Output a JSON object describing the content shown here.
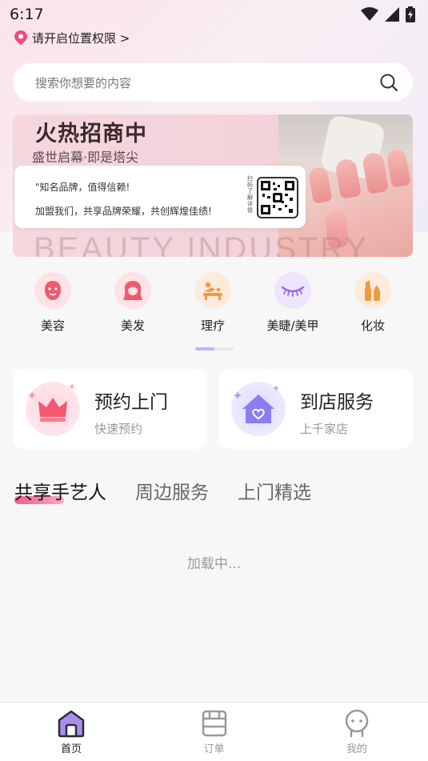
{
  "status_bar": {
    "time": "6:17"
  },
  "location": {
    "label": "请开启位置权限 >"
  },
  "search": {
    "placeholder": "搜索你想要的内容"
  },
  "banner": {
    "title": "火热招商中",
    "subtitle": "盛世启幕·即是塔尖",
    "card_line1": "\"知名品牌，值得信赖!",
    "card_line2": "加盟我们，共享品牌荣耀，共创辉煌佳绩!",
    "qr_label": "扫码了解详情",
    "watermark": "BEAUTY INDUSTRY"
  },
  "categories": [
    {
      "label": "美容",
      "icon": "face-mask-icon",
      "bg": "#fde2e6",
      "fg": "#ef5a6e"
    },
    {
      "label": "美发",
      "icon": "hair-icon",
      "bg": "#fde2e6",
      "fg": "#ef5a6e"
    },
    {
      "label": "理疗",
      "icon": "massage-icon",
      "bg": "#fdebdc",
      "fg": "#f09a3e"
    },
    {
      "label": "美睫/美甲",
      "icon": "eyelash-icon",
      "bg": "#eee4fb",
      "fg": "#9a6ae6"
    },
    {
      "label": "化妆",
      "icon": "makeup-icon",
      "bg": "#fdebdc",
      "fg": "#f09a3e"
    }
  ],
  "services": [
    {
      "title": "预约上门",
      "subtitle": "快速预约",
      "icon": "crown-icon"
    },
    {
      "title": "到店服务",
      "subtitle": "上千家店",
      "icon": "house-heart-icon"
    }
  ],
  "tabs": [
    {
      "label": "共享手艺人",
      "active": true
    },
    {
      "label": "周边服务",
      "active": false
    },
    {
      "label": "上门精选",
      "active": false
    }
  ],
  "loading_text": "加载中...",
  "tabbar": [
    {
      "label": "首页",
      "icon": "home-icon",
      "active": true
    },
    {
      "label": "订单",
      "icon": "order-icon",
      "active": false
    },
    {
      "label": "我的",
      "icon": "profile-icon",
      "active": false
    }
  ],
  "colors": {
    "accent": "#f04b7c",
    "purple": "#9a6ae6",
    "orange": "#f09a3e"
  }
}
